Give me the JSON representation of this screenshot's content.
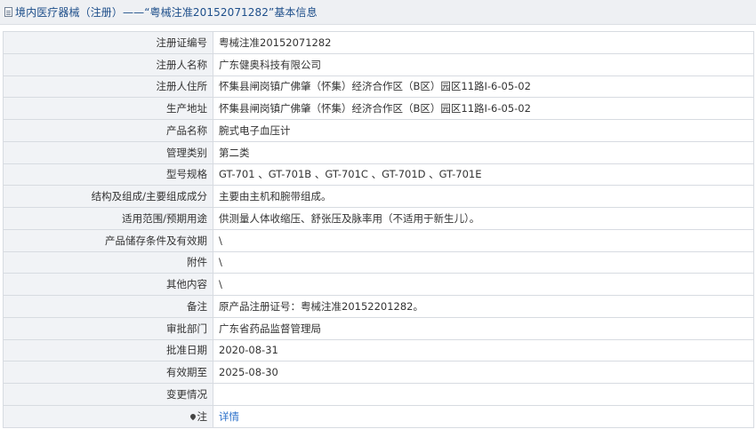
{
  "header": {
    "title": "境内医疗器械（注册）——“粤械注准20152071282”基本信息"
  },
  "rows": [
    {
      "label": "注册证编号",
      "value": "粤械注准20152071282"
    },
    {
      "label": "注册人名称",
      "value": "广东健奥科技有限公司"
    },
    {
      "label": "注册人住所",
      "value": "怀集县闸岗镇广佛肇（怀集）经济合作区（B区）园区11路I-6-05-02"
    },
    {
      "label": "生产地址",
      "value": "怀集县闸岗镇广佛肇（怀集）经济合作区（B区）园区11路I-6-05-02"
    },
    {
      "label": "产品名称",
      "value": "腕式电子血压计"
    },
    {
      "label": "管理类别",
      "value": "第二类"
    },
    {
      "label": "型号规格",
      "value": "GT-701 、GT-701B 、GT-701C 、GT-701D 、GT-701E"
    },
    {
      "label": "结构及组成/主要组成成分",
      "value": "主要由主机和腕带组成。"
    },
    {
      "label": "适用范围/预期用途",
      "value": "供测量人体收缩压、舒张压及脉率用（不适用于新生儿）。"
    },
    {
      "label": "产品储存条件及有效期",
      "value": "\\"
    },
    {
      "label": "附件",
      "value": "\\"
    },
    {
      "label": "其他内容",
      "value": "\\"
    },
    {
      "label": "备注",
      "value": "原产品注册证号：粤械注准20152201282。"
    },
    {
      "label": "审批部门",
      "value": "广东省药品监督管理局"
    },
    {
      "label": "批准日期",
      "value": "2020-08-31"
    },
    {
      "label": "有效期至",
      "value": "2025-08-30"
    },
    {
      "label": "变更情况",
      "value": ""
    }
  ],
  "note_row": {
    "label": "注",
    "icon": "pin-icon",
    "link_text": "详情",
    "link_color": "#2a6fc9"
  }
}
